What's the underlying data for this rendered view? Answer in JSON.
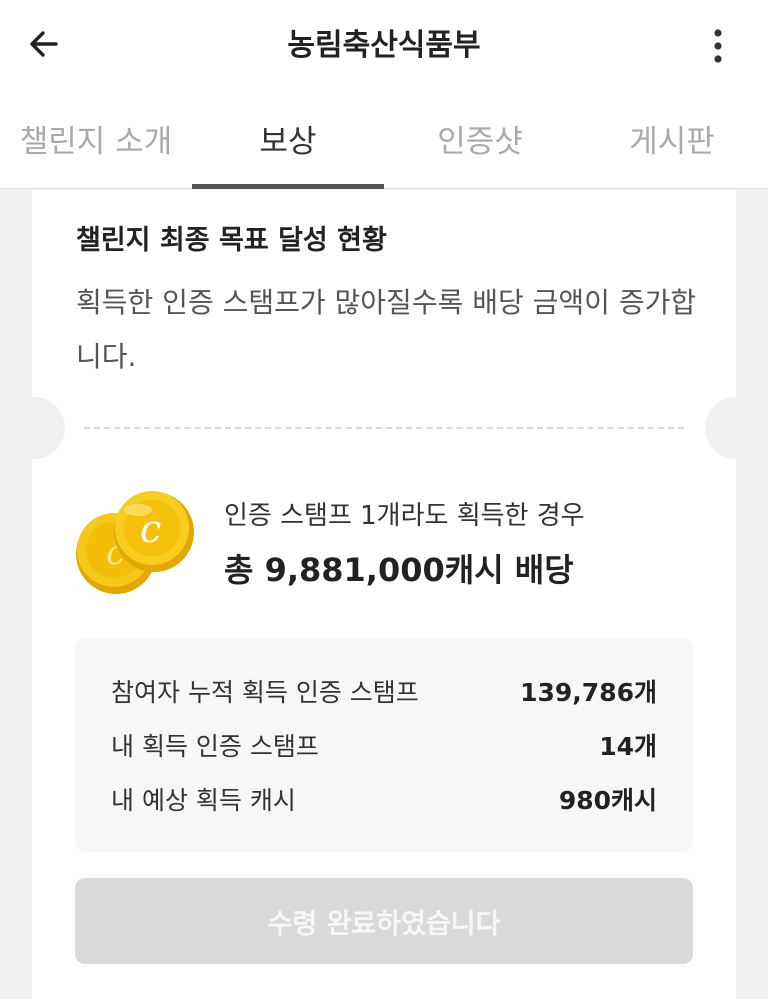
{
  "header": {
    "title": "농림축산식품부",
    "back_icon": "arrow-left-icon",
    "more_icon": "more-vertical-icon"
  },
  "tabs": [
    {
      "label": "챌린지 소개",
      "active": false
    },
    {
      "label": "보상",
      "active": true
    },
    {
      "label": "인증샷",
      "active": false
    },
    {
      "label": "게시판",
      "active": false
    }
  ],
  "goal": {
    "title": "챌린지 최종 목표 달성 현황",
    "description": "획득한 인증 스탬프가 많아질수록 배당 금액이 증가합니다."
  },
  "reward": {
    "coin_icon": "coin-icon",
    "condition": "인증 스탬프 1개라도 획득한 경우",
    "total": "총 9,881,000캐시 배당"
  },
  "stats": [
    {
      "label": "참여자 누적 획득 인증 스탬프",
      "value": "139,786개"
    },
    {
      "label": "내 획득 인증 스탬프",
      "value": "14개"
    },
    {
      "label": "내 예상 획득 캐시",
      "value": "980캐시"
    }
  ],
  "claim_button": {
    "label": "수령 완료하였습니다",
    "disabled": true
  },
  "colors": {
    "background": "#f1f0ef",
    "coin": "#f5c400",
    "active_tab_indicator": "#555555",
    "disabled_button": "#d9d9d9"
  }
}
